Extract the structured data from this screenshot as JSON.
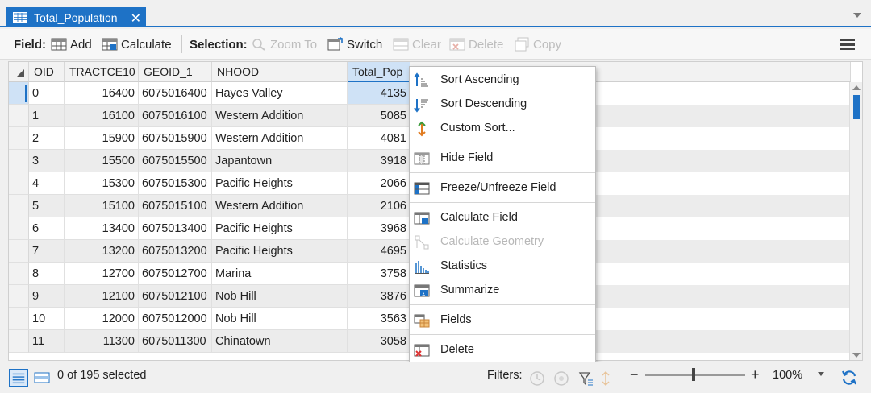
{
  "tab": {
    "title": "Total_Population",
    "close": "✕"
  },
  "toolbar": {
    "field_label": "Field:",
    "add": "Add",
    "calculate": "Calculate",
    "selection_label": "Selection:",
    "zoom_to": "Zoom To",
    "switch": "Switch",
    "clear": "Clear",
    "delete": "Delete",
    "copy": "Copy"
  },
  "table": {
    "columns": [
      "OID",
      "TRACTCE10",
      "GEOID_1",
      "NHOOD",
      "Total_Pop"
    ],
    "rows": [
      [
        "0",
        "16400",
        "6075016400",
        "Hayes Valley",
        "4135"
      ],
      [
        "1",
        "16100",
        "6075016100",
        "Western Addition",
        "5085"
      ],
      [
        "2",
        "15900",
        "6075015900",
        "Western Addition",
        "4081"
      ],
      [
        "3",
        "15500",
        "6075015500",
        "Japantown",
        "3918"
      ],
      [
        "4",
        "15300",
        "6075015300",
        "Pacific Heights",
        "2066"
      ],
      [
        "5",
        "15100",
        "6075015100",
        "Western Addition",
        "2106"
      ],
      [
        "6",
        "13400",
        "6075013400",
        "Pacific Heights",
        "3968"
      ],
      [
        "7",
        "13200",
        "6075013200",
        "Pacific Heights",
        "4695"
      ],
      [
        "8",
        "12700",
        "6075012700",
        "Marina",
        "3758"
      ],
      [
        "9",
        "12100",
        "6075012100",
        "Nob Hill",
        "3876"
      ],
      [
        "10",
        "12000",
        "6075012000",
        "Nob Hill",
        "3563"
      ],
      [
        "11",
        "11300",
        "6075011300",
        "Chinatown",
        "3058"
      ]
    ]
  },
  "context_menu": {
    "sort_ascending": "Sort Ascending",
    "sort_descending": "Sort Descending",
    "custom_sort": "Custom Sort...",
    "hide_field": "Hide Field",
    "freeze": "Freeze/Unfreeze Field",
    "calculate_field": "Calculate Field",
    "calculate_geometry": "Calculate Geometry",
    "statistics": "Statistics",
    "summarize": "Summarize",
    "fields": "Fields",
    "delete": "Delete"
  },
  "status": {
    "selected": "0 of 195 selected",
    "filters_label": "Filters:",
    "zoom_minus": "−",
    "zoom_plus": "+",
    "zoom_value": "100%"
  },
  "colors": {
    "accent": "#1e72c6",
    "selected_bg": "#cfe2f6"
  }
}
